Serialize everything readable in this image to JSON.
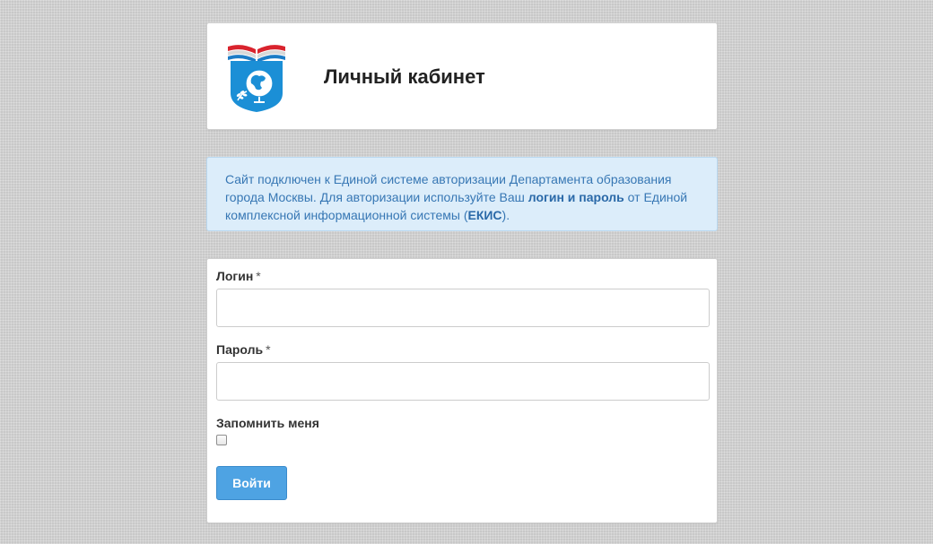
{
  "header": {
    "title": "Личный кабинет",
    "logo_icon": "education-department-emblem-icon"
  },
  "info": {
    "text_part1": "Сайт подключен к Единой системе авторизации Департамента образования города Москвы. Для авторизации используйте Ваш ",
    "bold_credentials": "логин и пароль",
    "text_part2": " от Единой комплексной информационной системы (",
    "bold_system": "ЕКИС",
    "text_part3": ")."
  },
  "form": {
    "login_label": "Логин",
    "login_value": "",
    "password_label": "Пароль",
    "password_value": "",
    "required_mark": "*",
    "remember_label": "Запомнить меня",
    "remember_checked": false,
    "submit_label": "Войти"
  },
  "colors": {
    "accent": "#4ea3e3",
    "info_background": "#dcedfa",
    "info_text": "#3777b4"
  }
}
